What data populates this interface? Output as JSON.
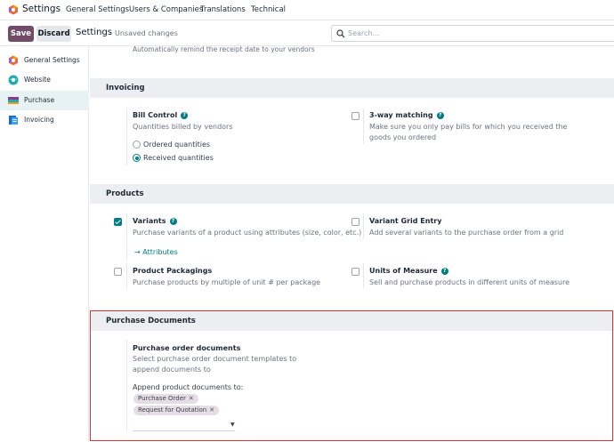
{
  "navbar": {
    "app_title": "Settings",
    "menu": [
      "General Settings",
      "Users & Companies",
      "Translations",
      "Technical"
    ]
  },
  "control_panel": {
    "save_label": "Save",
    "discard_label": "Discard",
    "breadcrumb": "Settings",
    "status": "Unsaved changes",
    "search_placeholder": "Search..."
  },
  "sidebar": {
    "items": [
      {
        "label": "General Settings",
        "icon": "odoo-logo-icon",
        "active": false
      },
      {
        "label": "Website",
        "icon": "website-icon",
        "active": false
      },
      {
        "label": "Purchase",
        "icon": "purchase-icon",
        "active": true
      },
      {
        "label": "Invoicing",
        "icon": "invoicing-icon",
        "active": false
      }
    ]
  },
  "main": {
    "cut_off_text": "Automatically remind the receipt date to your vendors",
    "invoicing": {
      "title": "Invoicing",
      "bill_control": {
        "title": "Bill Control",
        "desc": "Quantities billed by vendors",
        "options": [
          "Ordered quantities",
          "Received quantities"
        ],
        "selected": "Received quantities"
      },
      "three_way": {
        "title": "3-way matching",
        "desc": "Make sure you only pay bills for which you received the goods you ordered",
        "checked": false
      }
    },
    "products": {
      "title": "Products",
      "variants": {
        "title": "Variants",
        "desc": "Purchase variants of a product using attributes (size, color, etc.)",
        "checked": true,
        "link": "Attributes"
      },
      "variant_grid": {
        "title": "Variant Grid Entry",
        "desc": "Add several variants to the purchase order from a grid",
        "checked": false
      },
      "packagings": {
        "title": "Product Packagings",
        "desc": "Purchase products by multiple of unit # per package",
        "checked": false
      },
      "uom": {
        "title": "Units of Measure",
        "desc": "Sell and purchase products in different units of measure",
        "checked": false
      }
    },
    "purchase_documents": {
      "title": "Purchase Documents",
      "setting_title": "Purchase order documents",
      "setting_desc": "Select purchase order document templates to append documents to",
      "append_label": "Append product documents to:",
      "tags": [
        "Purchase Order",
        "Request for Quotation"
      ]
    }
  },
  "colors": {
    "brand": "#714b67",
    "accent": "#017e84",
    "highlight": "#e03131",
    "section_bg": "#eceef1"
  }
}
